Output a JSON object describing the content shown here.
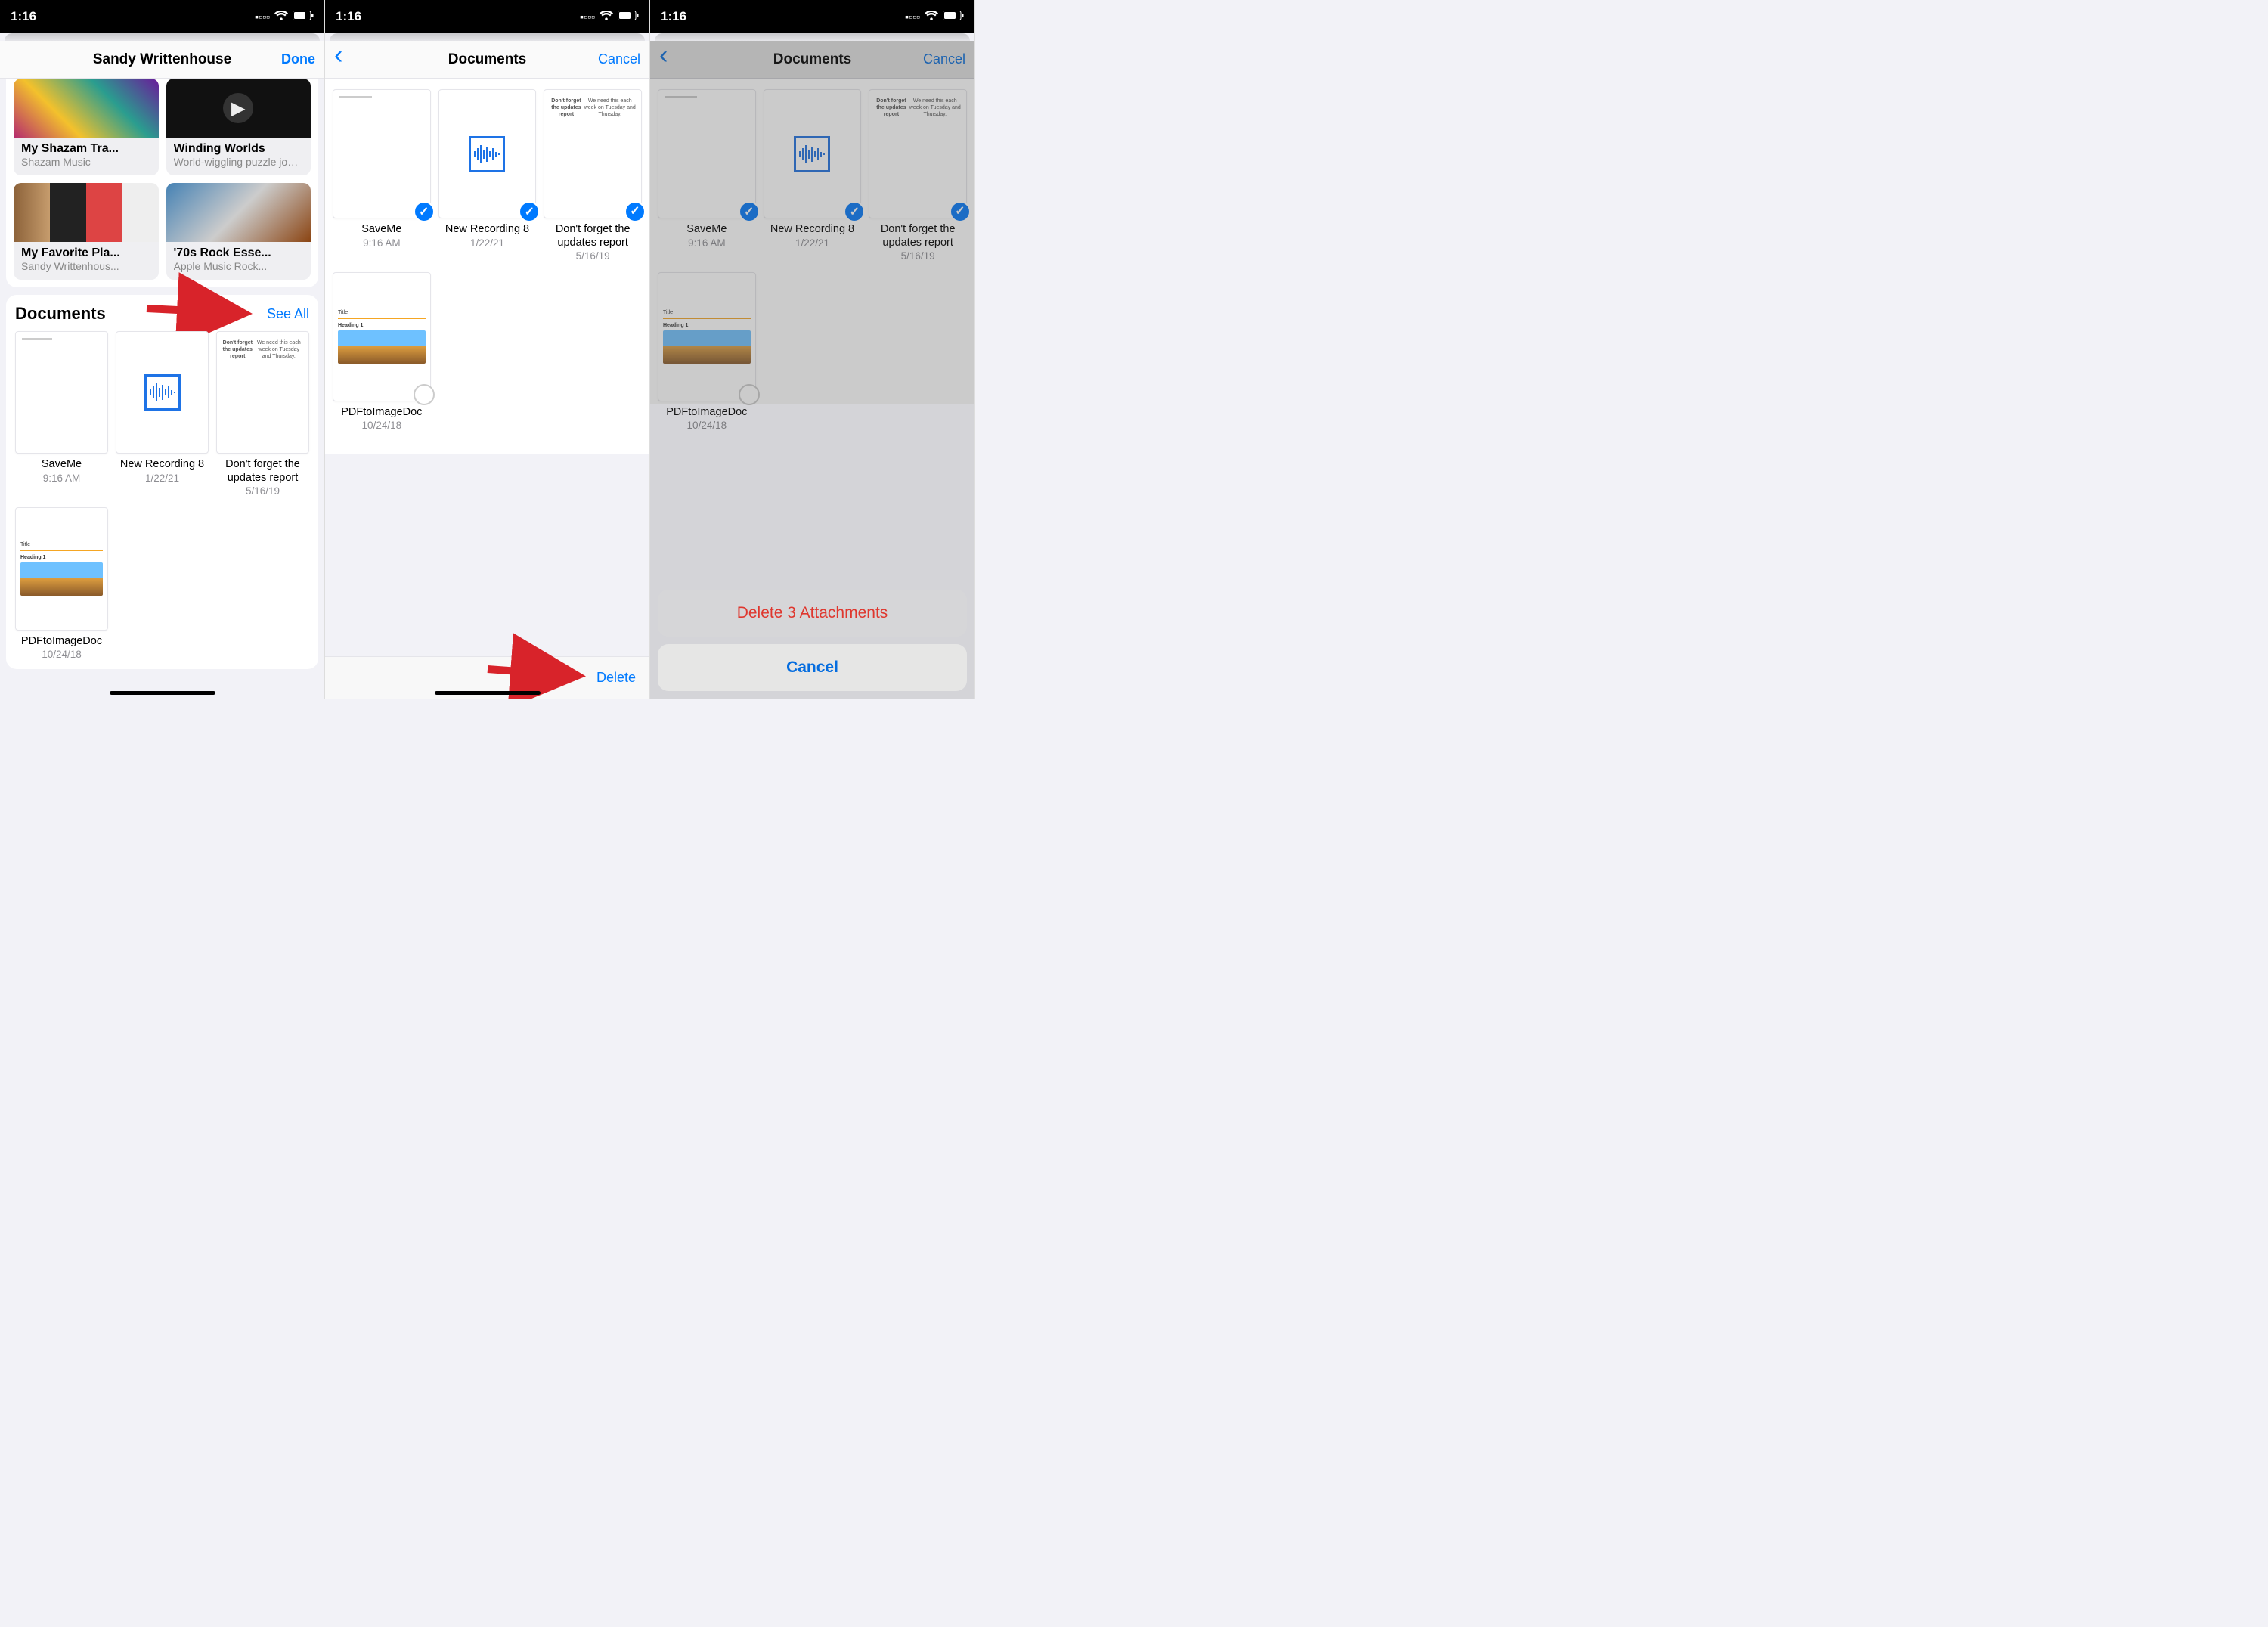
{
  "status": {
    "time": "1:16"
  },
  "phone1": {
    "nav": {
      "title": "Sandy Writtenhouse",
      "done": "Done"
    },
    "tiles": [
      {
        "title": "My Shazam Tra...",
        "subtitle": "Shazam Music"
      },
      {
        "title": "Winding Worlds",
        "subtitle": "World-wiggling puzzle journey"
      },
      {
        "title": "My Favorite Pla...",
        "subtitle": "Sandy Writtenhous..."
      },
      {
        "title": "'70s Rock Esse...",
        "subtitle": "Apple Music Rock..."
      }
    ],
    "documents": {
      "header": "Documents",
      "see_all": "See All",
      "items": [
        {
          "name": "SaveMe",
          "sub": "9:16 AM",
          "thumb": "plain"
        },
        {
          "name": "New Recording 8",
          "sub": "1/22/21",
          "thumb": "wave"
        },
        {
          "name": "Don't forget the updates report",
          "sub": "5/16/19",
          "thumb": "text",
          "text_hdr": "Don't forget the updates report",
          "text_body": "We need this each week on Tuesday and Thursday."
        },
        {
          "name": "PDFtoImageDoc",
          "sub": "10/24/18",
          "thumb": "pdf",
          "pdf_title": "Title",
          "pdf_heading": "Heading 1"
        }
      ]
    }
  },
  "phone2": {
    "nav": {
      "title": "Documents",
      "cancel": "Cancel"
    },
    "items": [
      {
        "name": "SaveMe",
        "sub": "9:16 AM",
        "thumb": "plain",
        "selected": true
      },
      {
        "name": "New Recording 8",
        "sub": "1/22/21",
        "thumb": "wave",
        "selected": true
      },
      {
        "name": "Don't forget the updates report",
        "sub": "5/16/19",
        "thumb": "text",
        "text_hdr": "Don't forget the updates report",
        "text_body": "We need this each week on Tuesday and Thursday.",
        "selected": true
      },
      {
        "name": "PDFtoImageDoc",
        "sub": "10/24/18",
        "thumb": "pdf",
        "pdf_title": "Title",
        "pdf_heading": "Heading 1",
        "selected": false
      }
    ],
    "toolbar": {
      "delete": "Delete"
    }
  },
  "phone3": {
    "nav": {
      "title": "Documents",
      "cancel": "Cancel"
    },
    "items": [
      {
        "name": "SaveMe",
        "sub": "9:16 AM",
        "thumb": "plain",
        "selected": true
      },
      {
        "name": "New Recording 8",
        "sub": "1/22/21",
        "thumb": "wave",
        "selected": true
      },
      {
        "name": "Don't forget the updates report",
        "sub": "5/16/19",
        "thumb": "text",
        "text_hdr": "Don't forget the updates report",
        "text_body": "We need this each week on Tuesday and Thursday.",
        "selected": true
      },
      {
        "name": "PDFtoImageDoc",
        "sub": "10/24/18",
        "thumb": "pdf",
        "pdf_title": "Title",
        "pdf_heading": "Heading 1",
        "selected": false
      }
    ],
    "sheet": {
      "delete": "Delete 3 Attachments",
      "cancel": "Cancel"
    }
  }
}
